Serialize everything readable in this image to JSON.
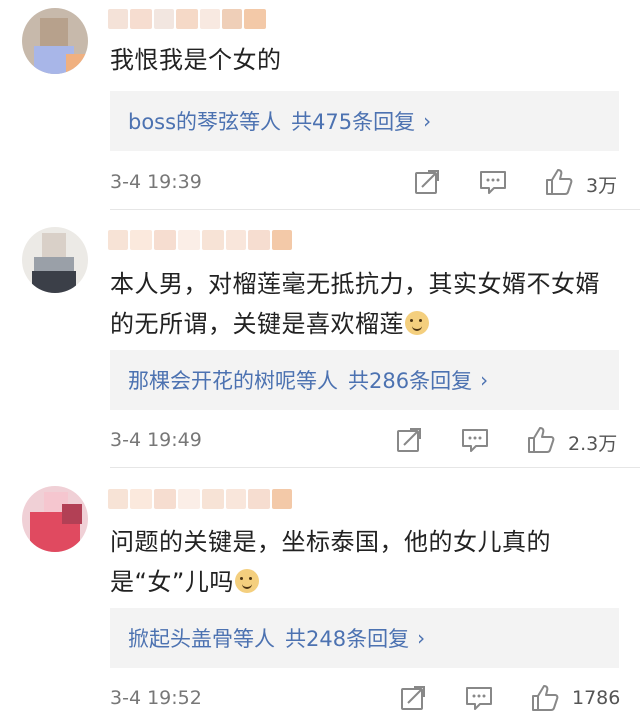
{
  "comments": [
    {
      "text": "我恨我是个女的",
      "text_emoji": false,
      "reply_user": "boss的琴弦",
      "reply_etc": "等人",
      "reply_count_text": "共475条回复",
      "reply_chevron": "›",
      "time": "3-4 19:39",
      "likes": "3万",
      "colors": {
        "avatar": [
          "#b7a18c",
          "#7e8aa0",
          "#a8b6e8",
          "#f0b080"
        ],
        "name": [
          "#f2d7c7",
          "#f7e7df",
          "#f3c9a8"
        ]
      }
    },
    {
      "text": "本人男，对榴莲毫无抵抗力，其实女婿不女婿的无所谓，关键是喜欢榴莲",
      "text_emoji": true,
      "reply_user": "那棵会开花的树呢",
      "reply_etc": "等人",
      "reply_count_text": "共286条回复",
      "reply_chevron": "›",
      "time": "3-4 19:49",
      "likes": "2.3万",
      "colors": {
        "avatar": [
          "#d9d0c8",
          "#3b3f48",
          "#9aa0a8",
          "#2f3238"
        ],
        "name": [
          "#f7dcc9",
          "#f3c9a8",
          "#fbe9dd"
        ]
      }
    },
    {
      "text": "问题的关键是，坐标泰国，他的女儿真的是“女”儿吗",
      "text_emoji": true,
      "reply_user": "掀起头盖骨",
      "reply_etc": "等人",
      "reply_count_text": "共248条回复",
      "reply_chevron": "›",
      "time": "3-4 19:52",
      "likes": "1786",
      "colors": {
        "avatar": [
          "#e04a60",
          "#f5c6cf",
          "#b24055",
          "#ec7a8c"
        ],
        "name": [
          "#f7dcc9",
          "#f3c9a8",
          "#fbe9dd"
        ]
      }
    }
  ],
  "icons": {
    "share": "share-icon",
    "comment": "comment-icon",
    "like": "thumbs-up-icon"
  },
  "accent_color": "#4c72b1"
}
